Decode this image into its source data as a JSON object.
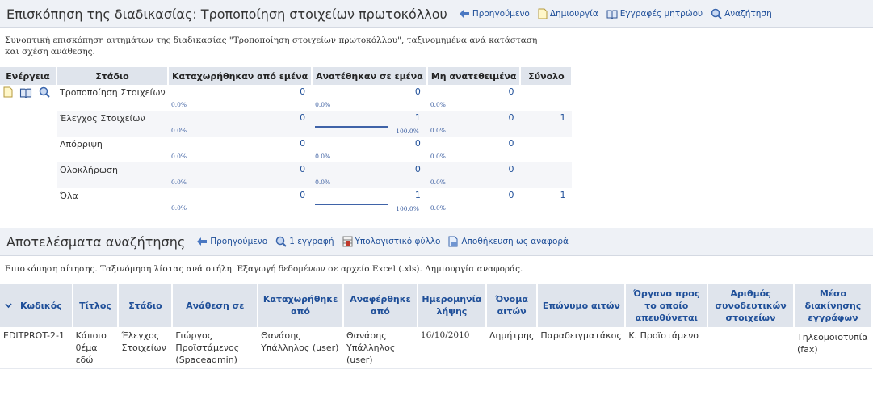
{
  "overview": {
    "title": "Επισκόπηση της διαδικασίας: Τροποποίηση στοιχείων πρωτοκόλλου",
    "links": [
      {
        "label": "Προηγούμενο",
        "icon": "back-arrow-icon"
      },
      {
        "label": "Δημιουργία",
        "icon": "new-document-icon"
      },
      {
        "label": "Εγγραφές μητρώου",
        "icon": "book-icon"
      },
      {
        "label": "Αναζήτηση",
        "icon": "search-icon"
      }
    ],
    "description": "Συνοπτική επισκόπηση αιτημάτων της διαδικασίας \"Τροποποίηση στοιχείων πρωτοκόλλου\", ταξινομημένα ανά κατάσταση και σχέση ανάθεσης.",
    "table": {
      "headers": [
        "Ενέργεια",
        "Στάδιο",
        "Καταχωρήθηκαν από εμένα",
        "Ανατέθηκαν σε εμένα",
        "Μη ανατεθειμένα",
        "Σύνολο"
      ],
      "rows": [
        {
          "stage": "Τροποποίηση Στοιχείων",
          "mine": "0",
          "mine_pct": "0.0%",
          "assigned": "0",
          "assigned_pct": "0.0%",
          "unassigned": "0",
          "unassigned_pct": "0.0%",
          "total": ""
        },
        {
          "stage": "Έλεγχος Στοιχείων",
          "mine": "0",
          "mine_pct": "0.0%",
          "assigned": "1",
          "assigned_pct": "100.0%",
          "unassigned": "0",
          "unassigned_pct": "0.0%",
          "total": "1"
        },
        {
          "stage": "Απόρριψη",
          "mine": "0",
          "mine_pct": "0.0%",
          "assigned": "0",
          "assigned_pct": "0.0%",
          "unassigned": "0",
          "unassigned_pct": "0.0%",
          "total": ""
        },
        {
          "stage": "Ολοκλήρωση",
          "mine": "0",
          "mine_pct": "0.0%",
          "assigned": "0",
          "assigned_pct": "0.0%",
          "unassigned": "0",
          "unassigned_pct": "0.0%",
          "total": ""
        },
        {
          "stage": "Όλα",
          "mine": "0",
          "mine_pct": "0.0%",
          "assigned": "1",
          "assigned_pct": "100.0%",
          "unassigned": "0",
          "unassigned_pct": "0.0%",
          "total": "1"
        }
      ]
    }
  },
  "results": {
    "title": "Αποτελέσματα αναζήτησης",
    "links": [
      {
        "label": "Προηγούμενο",
        "icon": "back-arrow-icon"
      },
      {
        "label": "1 εγγραφή",
        "icon": "search-icon"
      },
      {
        "label": "Υπολογιστικό φύλλο",
        "icon": "spreadsheet-icon"
      },
      {
        "label": "Αποθήκευση ως αναφορά",
        "icon": "save-report-icon"
      }
    ],
    "description": "Επισκόπηση αίτησης. Ταξινόμηση λίστας ανά στήλη. Εξαγωγή δεδομένων σε αρχείο Excel (.xls). Δημιουργία αναφοράς.",
    "headers": [
      "Κωδικός",
      "Τίτλος",
      "Στάδιο",
      "Ανάθεση σε",
      "Καταχωρήθηκε από",
      "Αναφέρθηκε από",
      "Ημερομηνία λήψης",
      "Όνομα αιτών",
      "Επώνυμο αιτών",
      "Όργανο προς το οποίο απευθύνεται",
      "Αριθμός συνοδευτικών στοιχείων",
      "Μέσο διακίνησης εγγράφων"
    ],
    "rows": [
      {
        "code": "EDITPROT-2-1",
        "title": "Κάποιο θέμα εδώ",
        "stage": "Έλεγχος Στοιχείων",
        "assigned_to": "Γιώργος Προϊστάμενος (Spaceadmin)",
        "registered_by": "Θανάσης Υπάλληλος (user)",
        "reported_by": "Θανάσης Υπάλληλος (user)",
        "received_date": "16/10/2010",
        "first_name": "Δημήτρης",
        "last_name": "Παραδειγματάκος",
        "addressed_to": "Κ. Προϊστάμενο",
        "attachments": "",
        "delivery_method": "Τηλεομοιοτυπία (fax)"
      }
    ]
  },
  "colors": {
    "header_bg": "#eef1f6",
    "table_header_bg": "#dfe4ec",
    "link": "#1f4f99",
    "bar": "#3f63a8"
  }
}
